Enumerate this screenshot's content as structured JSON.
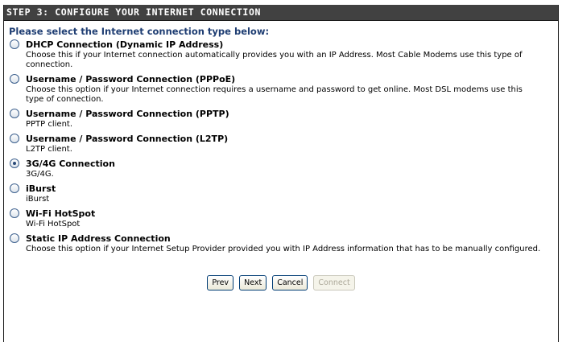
{
  "header": {
    "title": "STEP 3: CONFIGURE YOUR INTERNET CONNECTION"
  },
  "prompt": "Please select the Internet connection type below:",
  "options": [
    {
      "label": "DHCP Connection (Dynamic IP Address)",
      "description": "Choose this if your Internet connection automatically provides you with an IP Address. Most Cable Modems use this type of connection.",
      "selected": false
    },
    {
      "label": "Username / Password Connection (PPPoE)",
      "description": "Choose this option if your Internet connection requires a username and password to get online. Most DSL modems use this type of connection.",
      "selected": false
    },
    {
      "label": "Username / Password Connection (PPTP)",
      "description": "PPTP client.",
      "selected": false
    },
    {
      "label": "Username / Password Connection (L2TP)",
      "description": "L2TP client.",
      "selected": false
    },
    {
      "label": "3G/4G Connection",
      "description": "3G/4G.",
      "selected": true
    },
    {
      "label": "iBurst",
      "description": "iBurst",
      "selected": false
    },
    {
      "label": "Wi-Fi HotSpot",
      "description": "Wi-Fi HotSpot",
      "selected": false
    },
    {
      "label": "Static IP Address Connection",
      "description": "Choose this option if your Internet Setup Provider provided you with IP Address information that has to be manually configured.",
      "selected": false
    }
  ],
  "buttons": {
    "prev": "Prev",
    "next": "Next",
    "cancel": "Cancel",
    "connect": "Connect"
  },
  "colors": {
    "header_bg": "#414141",
    "prompt_text": "#1f3e73"
  }
}
